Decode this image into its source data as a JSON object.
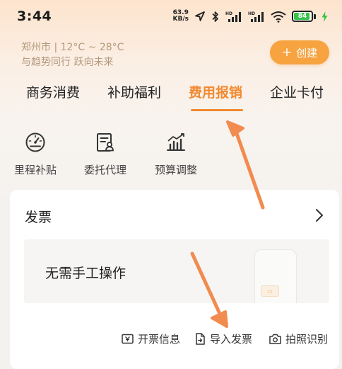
{
  "status_bar": {
    "time": "3:44",
    "net_speed_value": "63.9",
    "net_speed_unit": "KB/s",
    "hd_label": "HD",
    "battery_level": "84"
  },
  "header": {
    "weather_line": "郑州市 | 12°C ~ 28°C",
    "slogan": "与趋势同行 跃向未来",
    "create_icon": "+",
    "create_label": "创建"
  },
  "tabs": [
    {
      "label": "商务消费",
      "active": false
    },
    {
      "label": "补助福利",
      "active": false
    },
    {
      "label": "费用报销",
      "active": true
    },
    {
      "label": "企业卡付",
      "active": false
    }
  ],
  "quick_actions": [
    {
      "label": "里程补贴",
      "icon": "speedometer-icon"
    },
    {
      "label": "委托代理",
      "icon": "delegate-document-icon"
    },
    {
      "label": "预算调整",
      "icon": "bar-chart-icon"
    }
  ],
  "invoice_card": {
    "title": "发票",
    "banner_text": "无需手工操作",
    "actions": [
      {
        "label": "开票信息",
        "icon": "invoice-info-icon"
      },
      {
        "label": "导入发票",
        "icon": "import-file-icon"
      },
      {
        "label": "拍照识别",
        "icon": "camera-icon"
      }
    ]
  },
  "colors": {
    "accent": "#f1892f",
    "create_button": "#f6a340",
    "annotation_arrow": "#f28b4f",
    "battery": "#38c24a"
  }
}
